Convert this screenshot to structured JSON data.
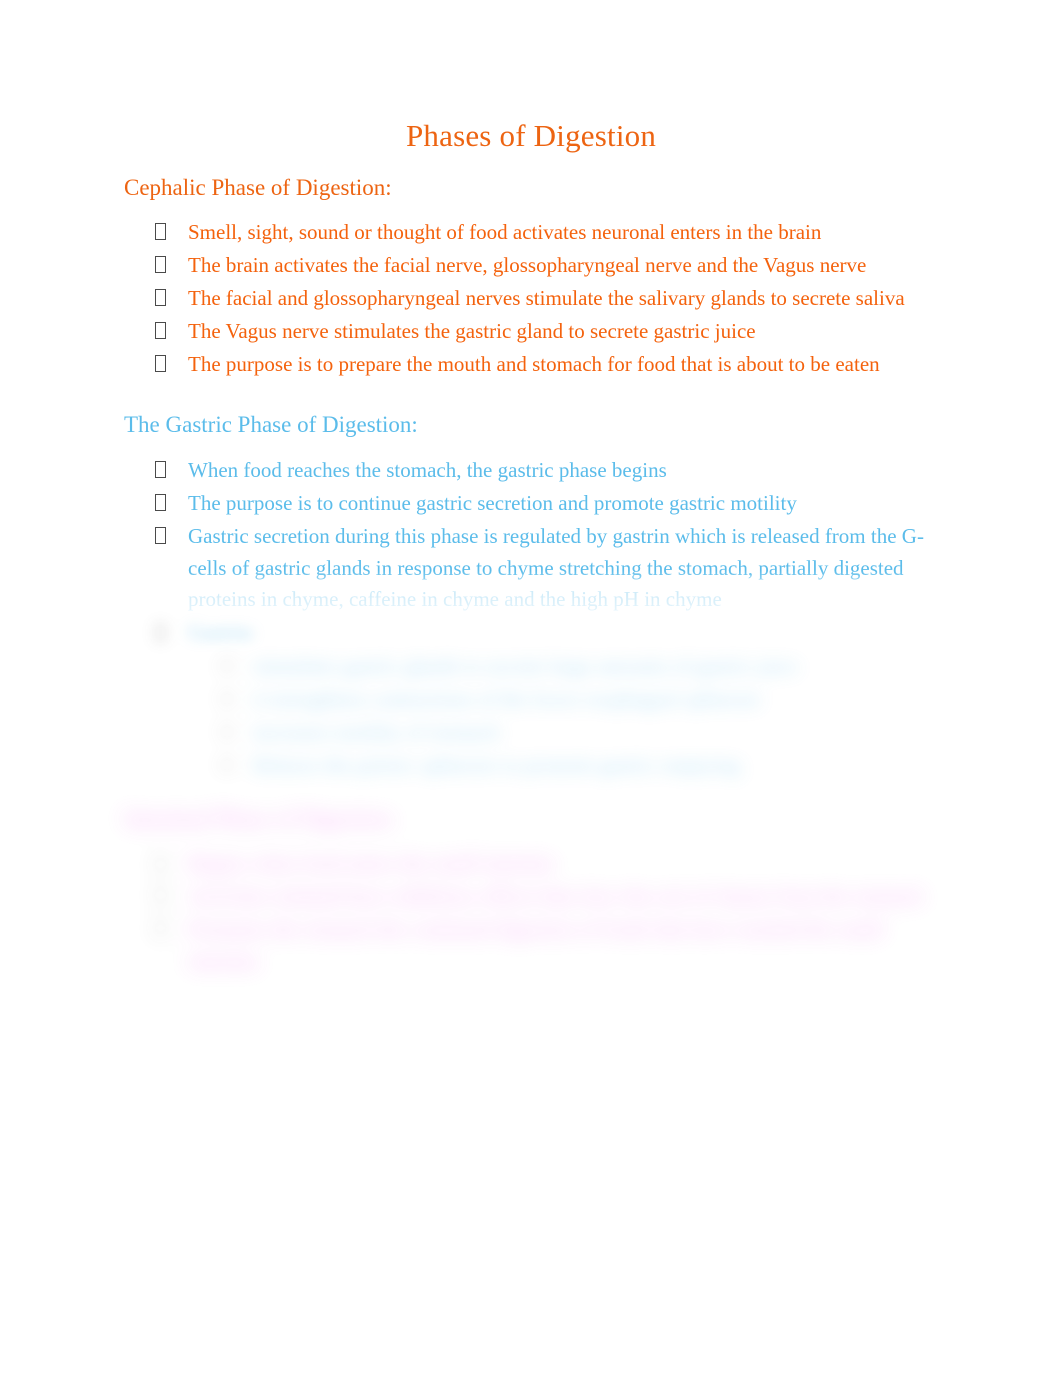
{
  "document": {
    "title": "Phases of Digestion",
    "colors": {
      "orange": "#F4620D",
      "blue": "#5BBCEA",
      "pink": "#EE44EE",
      "background": "#FFFFFF",
      "bullet_glyph": "#4A4A4A"
    }
  },
  "sections": [
    {
      "id": "cephalic",
      "heading": "Cephalic Phase of Digestion:",
      "color": "#F4620D",
      "bullets": [
        "Smell, sight, sound or thought of food activates neuronal enters in the brain",
        "The brain activates the facial nerve, glossopharyngeal nerve and the Vagus nerve",
        "The facial and glossopharyngeal nerves stimulate the salivary glands to secrete saliva",
        "The Vagus nerve stimulates the gastric gland to secrete gastric juice",
        "The purpose is to prepare the mouth and stomach for food that is about to be eaten"
      ]
    },
    {
      "id": "gastric",
      "heading": "The Gastric Phase of Digestion:",
      "color": "#5BBCEA",
      "bullets": [
        "When food reaches the stomach, the gastric phase begins",
        "The purpose is to continue gastric secretion and promote gastric motility",
        "Gastric secretion during this phase is regulated by gastrin which is released from the G-cells of gastric glands in response to chyme stretching the stomach, partially digested proteins in chyme, caffeine in chyme and the high pH in chyme",
        "Gastrin:"
      ],
      "subbullets": [
        "stimulates gastric glands to secrete large amounts of gastric juice",
        "it strengthens contractions of the lower esophageal sphincter",
        "increases motility of stomach",
        "Relaxes the pyloric sphincter to promote gastric emptying"
      ]
    },
    {
      "id": "intestinal",
      "heading": "Intestinal Phase of Digestion:",
      "color": "#EE44EE",
      "bullets": [
        "Begins when food enters the small intestine",
        "Activities initiated have inhibitory effects that slow the exit of chyme from the stomach",
        "Promotes the stomach the continued digestion of foods that have reached the small intestine"
      ]
    }
  ]
}
